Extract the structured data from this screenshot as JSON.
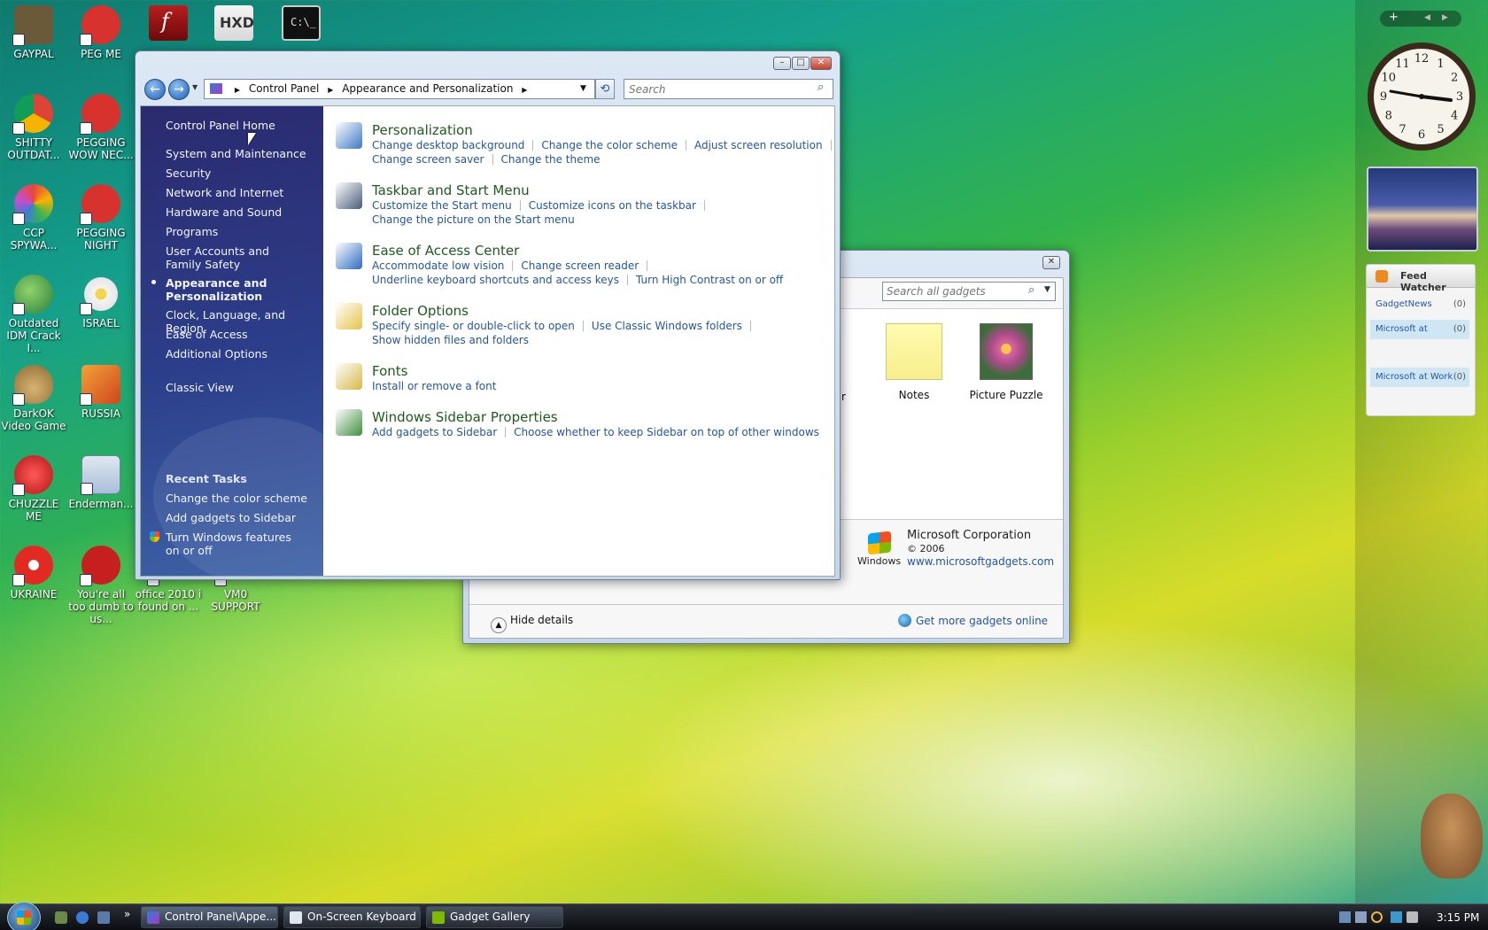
{
  "desktop": {
    "icons": [
      {
        "label": "GAYPAL",
        "color": "#6b5a3a"
      },
      {
        "label": "PEG ME",
        "color": "#d8322f"
      },
      {
        "label": "SHITTY OUTDAT...",
        "color": "#e6a321"
      },
      {
        "label": "PEGGING WOW NEC...",
        "color": "#d8322f"
      },
      {
        "label": "CCP SPYWA...",
        "color": "#c64fc7"
      },
      {
        "label": "PEGGING NIGHT",
        "color": "#d8322f"
      },
      {
        "label": "Outdated IDM Crack I...",
        "color": "#3ca35a"
      },
      {
        "label": "ISRAEL",
        "color": "#e8e8e8"
      },
      {
        "label": "DarkOK Video Game",
        "color": "#c49a4f"
      },
      {
        "label": "RUSSIA",
        "color": "#e47a1d"
      },
      {
        "label": "CHUZZLE ME",
        "color": "#d02b2b"
      },
      {
        "label": "Enderman...",
        "color": "#dfe8f0"
      },
      {
        "label": "UKRAINE",
        "color": "#e02a22"
      },
      {
        "label": "You're all too dumb to us...",
        "color": "#c61f1f"
      },
      {
        "label": "office 2010 i found on ...",
        "color": "#f0f0f0"
      },
      {
        "label": "VM0 SUPPORT",
        "color": "#e6e6e6"
      }
    ]
  },
  "control_panel": {
    "breadcrumb": [
      "Control Panel",
      "Appearance and Personalization"
    ],
    "search_placeholder": "Search",
    "nav": {
      "home": "Control Panel Home",
      "items": [
        "System and Maintenance",
        "Security",
        "Network and Internet",
        "Hardware and Sound",
        "Programs",
        "User Accounts and Family Safety",
        "Appearance and Personalization",
        "Clock, Language, and Region",
        "Ease of Access",
        "Additional Options"
      ],
      "classic_view": "Classic View",
      "recent_title": "Recent Tasks",
      "recent": [
        "Change the color scheme",
        "Add gadgets to Sidebar",
        "Turn Windows features on or off"
      ]
    },
    "categories": [
      {
        "title": "Personalization",
        "icon_color": "#3b79c4",
        "lines": [
          [
            "Change desktop background",
            "Change the color scheme",
            "Adjust screen resolution"
          ],
          [
            "Change screen saver",
            "Change the theme"
          ]
        ]
      },
      {
        "title": "Taskbar and Start Menu",
        "icon_color": "#4a5c7a",
        "lines": [
          [
            "Customize the Start menu",
            "Customize icons on the taskbar"
          ],
          [
            "Change the picture on the Start menu"
          ]
        ]
      },
      {
        "title": "Ease of Access Center",
        "icon_color": "#2d6cc0",
        "lines": [
          [
            "Accommodate low vision",
            "Change screen reader"
          ],
          [
            "Underline keyboard shortcuts and access keys",
            "Turn High Contrast on or off"
          ]
        ]
      },
      {
        "title": "Folder Options",
        "icon_color": "#e6c34a",
        "lines": [
          [
            "Specify single- or double-click to open",
            "Use Classic Windows folders"
          ],
          [
            "Show hidden files and folders"
          ]
        ]
      },
      {
        "title": "Fonts",
        "icon_color": "#d9b847",
        "lines": [
          [
            "Install or remove a font"
          ]
        ]
      },
      {
        "title": "Windows Sidebar Properties",
        "icon_color": "#3f8f3f",
        "lines": [
          [
            "Add gadgets to Sidebar",
            "Choose whether to keep Sidebar on top of other windows"
          ]
        ]
      }
    ]
  },
  "gadget_gallery": {
    "search_placeholder": "Search all gadgets",
    "partial_label": "r",
    "items": [
      "Notes",
      "Picture Puzzle"
    ],
    "publisher": "Microsoft Corporation",
    "copyright": "© 2006",
    "brand": "Windows",
    "url": "www.microsoftgadgets.com",
    "hide_details": "Hide details",
    "get_more": "Get more gadgets online"
  },
  "sidebar": {
    "add": "+",
    "feed_title": "Feed Watcher",
    "feeds": [
      {
        "name": "GadgetNews",
        "count": "(0)"
      },
      {
        "name": "Microsoft at",
        "count": "(0)"
      },
      {
        "name": "Microsoft at Work",
        "count": "(0)"
      }
    ],
    "clock_numbers": [
      "12",
      "1",
      "2",
      "3",
      "4",
      "5",
      "6",
      "7",
      "8",
      "9",
      "10",
      "11"
    ]
  },
  "taskbar": {
    "buttons": [
      "Control Panel\\Appe...",
      "On-Screen Keyboard",
      "Gadget Gallery"
    ],
    "clock": "3:15 PM",
    "show_more": "»"
  },
  "colors": {
    "link": "#2456a5",
    "category_title": "#1c5c1c",
    "nav_bg": "#2c3f8b"
  }
}
